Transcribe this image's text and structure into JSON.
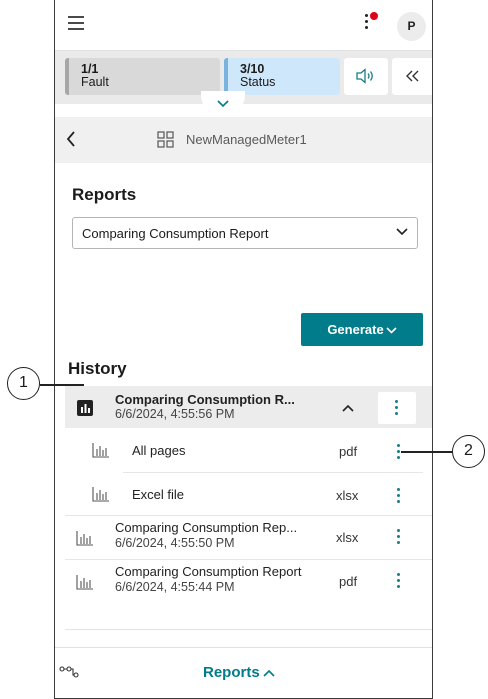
{
  "header": {
    "avatar_initial": "P"
  },
  "status": {
    "fault_count": "1/1",
    "fault_label": "Fault",
    "status_count": "3/10",
    "status_label": "Status"
  },
  "breadcrumb": {
    "device_name": "NewManagedMeter1"
  },
  "reports": {
    "title": "Reports",
    "selected_report": "Comparing Consumption Report",
    "generate_label": "Generate"
  },
  "history": {
    "title": "History",
    "items": [
      {
        "title": "Comparing Consumption R...",
        "date": "6/6/2024, 4:55:56 PM"
      },
      {
        "title": "Comparing Consumption Rep...",
        "date": "6/6/2024, 4:55:50 PM",
        "format": "xlsx"
      },
      {
        "title": "Comparing Consumption Report",
        "date": "6/6/2024, 4:55:44 PM",
        "format": "pdf"
      }
    ],
    "sub_items": [
      {
        "label": "All pages",
        "format": "pdf"
      },
      {
        "label": "Excel file",
        "format": "xlsx"
      }
    ]
  },
  "bottom": {
    "title": "Reports"
  },
  "callouts": {
    "one": "1",
    "two": "2"
  },
  "colors": {
    "accent": "#007c8a",
    "notification": "#e3001b",
    "status_chip": "#cfe7fa"
  }
}
